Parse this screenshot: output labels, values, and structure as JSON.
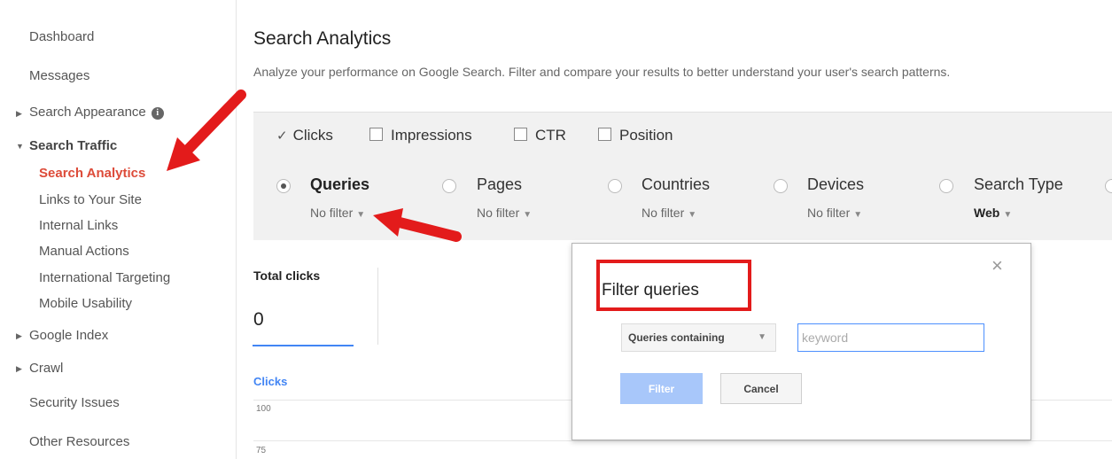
{
  "sidebar": {
    "dashboard": "Dashboard",
    "messages": "Messages",
    "search_appearance": "Search Appearance",
    "search_traffic": "Search Traffic",
    "search_traffic_items": [
      "Search Analytics",
      "Links to Your Site",
      "Internal Links",
      "Manual Actions",
      "International Targeting",
      "Mobile Usability"
    ],
    "google_index": "Google Index",
    "crawl": "Crawl",
    "security_issues": "Security Issues",
    "other_resources": "Other Resources"
  },
  "page": {
    "title": "Search Analytics",
    "description": "Analyze your performance on Google Search. Filter and compare your results to better understand your user's search patterns."
  },
  "metrics": {
    "clicks": "Clicks",
    "impressions": "Impressions",
    "ctr": "CTR",
    "position": "Position",
    "clicks_checked": true
  },
  "dimensions": [
    {
      "label": "Queries",
      "filter": "No filter",
      "selected": true
    },
    {
      "label": "Pages",
      "filter": "No filter",
      "selected": false
    },
    {
      "label": "Countries",
      "filter": "No filter",
      "selected": false
    },
    {
      "label": "Devices",
      "filter": "No filter",
      "selected": false
    },
    {
      "label": "Search Type",
      "filter": "Web",
      "selected": false
    }
  ],
  "totals": {
    "label": "Total clicks",
    "value": "0"
  },
  "chart": {
    "label": "Clicks",
    "ticks": [
      "100",
      "75"
    ]
  },
  "dialog": {
    "title": "Filter queries",
    "select_value": "Queries containing",
    "input_placeholder": "keyword",
    "filter_button": "Filter",
    "cancel_button": "Cancel",
    "close_glyph": "×"
  },
  "colors": {
    "accent": "#4285f4",
    "active_nav": "#dd4b39",
    "annotation_red": "#e31b1b",
    "panel_bg": "#f1f1f1"
  }
}
